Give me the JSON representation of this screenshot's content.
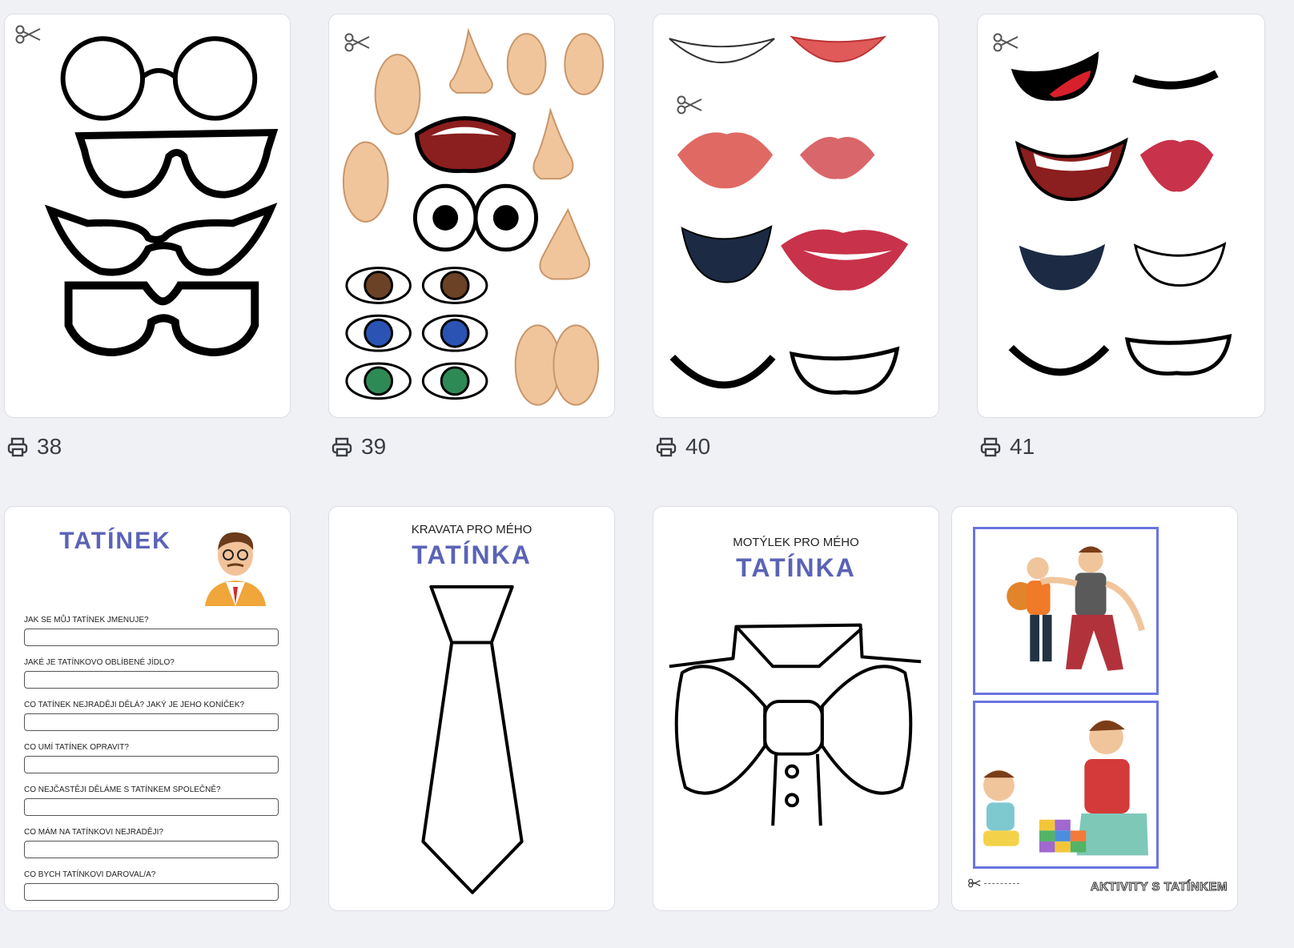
{
  "cards": [
    {
      "number": "38",
      "subject": "glasses"
    },
    {
      "number": "39",
      "subject": "face-parts"
    },
    {
      "number": "40",
      "subject": "mouths"
    },
    {
      "number": "41",
      "subject": "cartoon-mouths"
    }
  ],
  "profile_sheet": {
    "title": "TATÍNEK",
    "questions": [
      "JAK SE MŮJ TATÍNEK JMENUJE?",
      "JAKÉ JE TATÍNKOVO OBLÍBENÉ JÍDLO?",
      "CO TATÍNEK NEJRADĚJI DĚLÁ? JAKÝ JE JEHO KONÍČEK?",
      "CO UMÍ TATÍNEK OPRAVIT?",
      "CO NEJČASTĚJI DĚLÁME S TATÍNKEM SPOLEČNĚ?",
      "CO MÁM NA TATÍNKOVI NEJRADĚJI?",
      "CO BYCH TATÍNKOVI DAROVAL/A?"
    ]
  },
  "tie_sheet": {
    "subtitle": "KRAVATA PRO MÉHO",
    "title": "TATÍNKA"
  },
  "bowtie_sheet": {
    "subtitle": "MOTÝLEK PRO MÉHO",
    "title": "TATÍNKA"
  },
  "activity_sheet": {
    "footer": "AKTIVITY S TATÍNKEM"
  },
  "icons": {
    "print": "printer-icon",
    "cut": "scissors-icon"
  },
  "colors": {
    "accent": "#5b63b7",
    "frame": "#6b74e0",
    "background": "#f0f1f5"
  }
}
